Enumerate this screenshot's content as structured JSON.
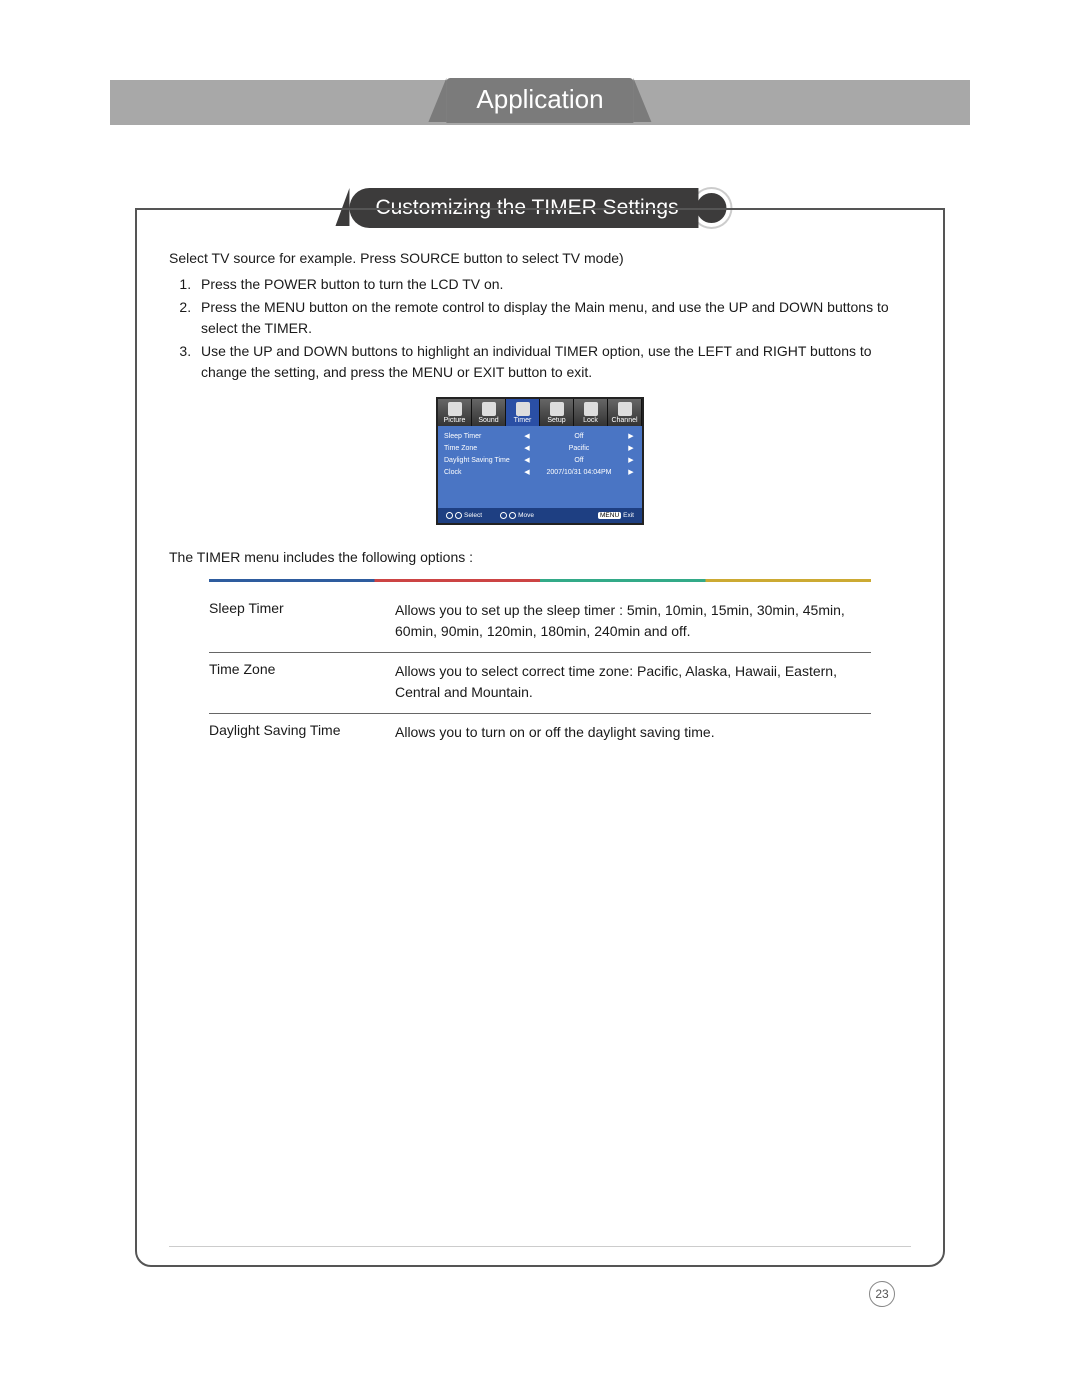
{
  "header": {
    "chapter": "Application",
    "section": "Customizing the TIMER Settings"
  },
  "intro": "Select TV source for example. Press SOURCE button to select TV mode)",
  "steps": [
    "Press the POWER button to turn the LCD TV on.",
    "Press the MENU button on the remote control to display the Main menu, and use the UP and DOWN buttons to select the TIMER.",
    "Use the UP and DOWN buttons to highlight an individual TIMER option, use the LEFT and RIGHT buttons to change the setting, and press the MENU or EXIT button to exit."
  ],
  "osd": {
    "tabs": [
      "Picture",
      "Sound",
      "Timer",
      "Setup",
      "Lock",
      "Channel"
    ],
    "active_tab_index": 2,
    "rows": [
      {
        "label": "Sleep Timer",
        "value": "Off"
      },
      {
        "label": "Time Zone",
        "value": "Pacific"
      },
      {
        "label": "Daylight Saving Time",
        "value": "Off"
      },
      {
        "label": "Clock",
        "value": "2007/10/31 04:04PM"
      }
    ],
    "footer": {
      "select": "Select",
      "move": "Move",
      "exit": "Exit",
      "exit_key": "MENU"
    }
  },
  "post_text": "The TIMER menu includes the following options :",
  "options": [
    {
      "name": "Sleep Timer",
      "desc": "Allows you to set up the sleep timer : 5min, 10min, 15min, 30min, 45min, 60min, 90min, 120min, 180min, 240min and off."
    },
    {
      "name": "Time Zone",
      "desc": "Allows you to select correct time zone: Pacific, Alaska, Hawaii, Eastern, Central and Mountain."
    },
    {
      "name": "Daylight Saving Time",
      "desc": "Allows you to turn on or off the daylight saving time."
    }
  ],
  "page_number": "23"
}
